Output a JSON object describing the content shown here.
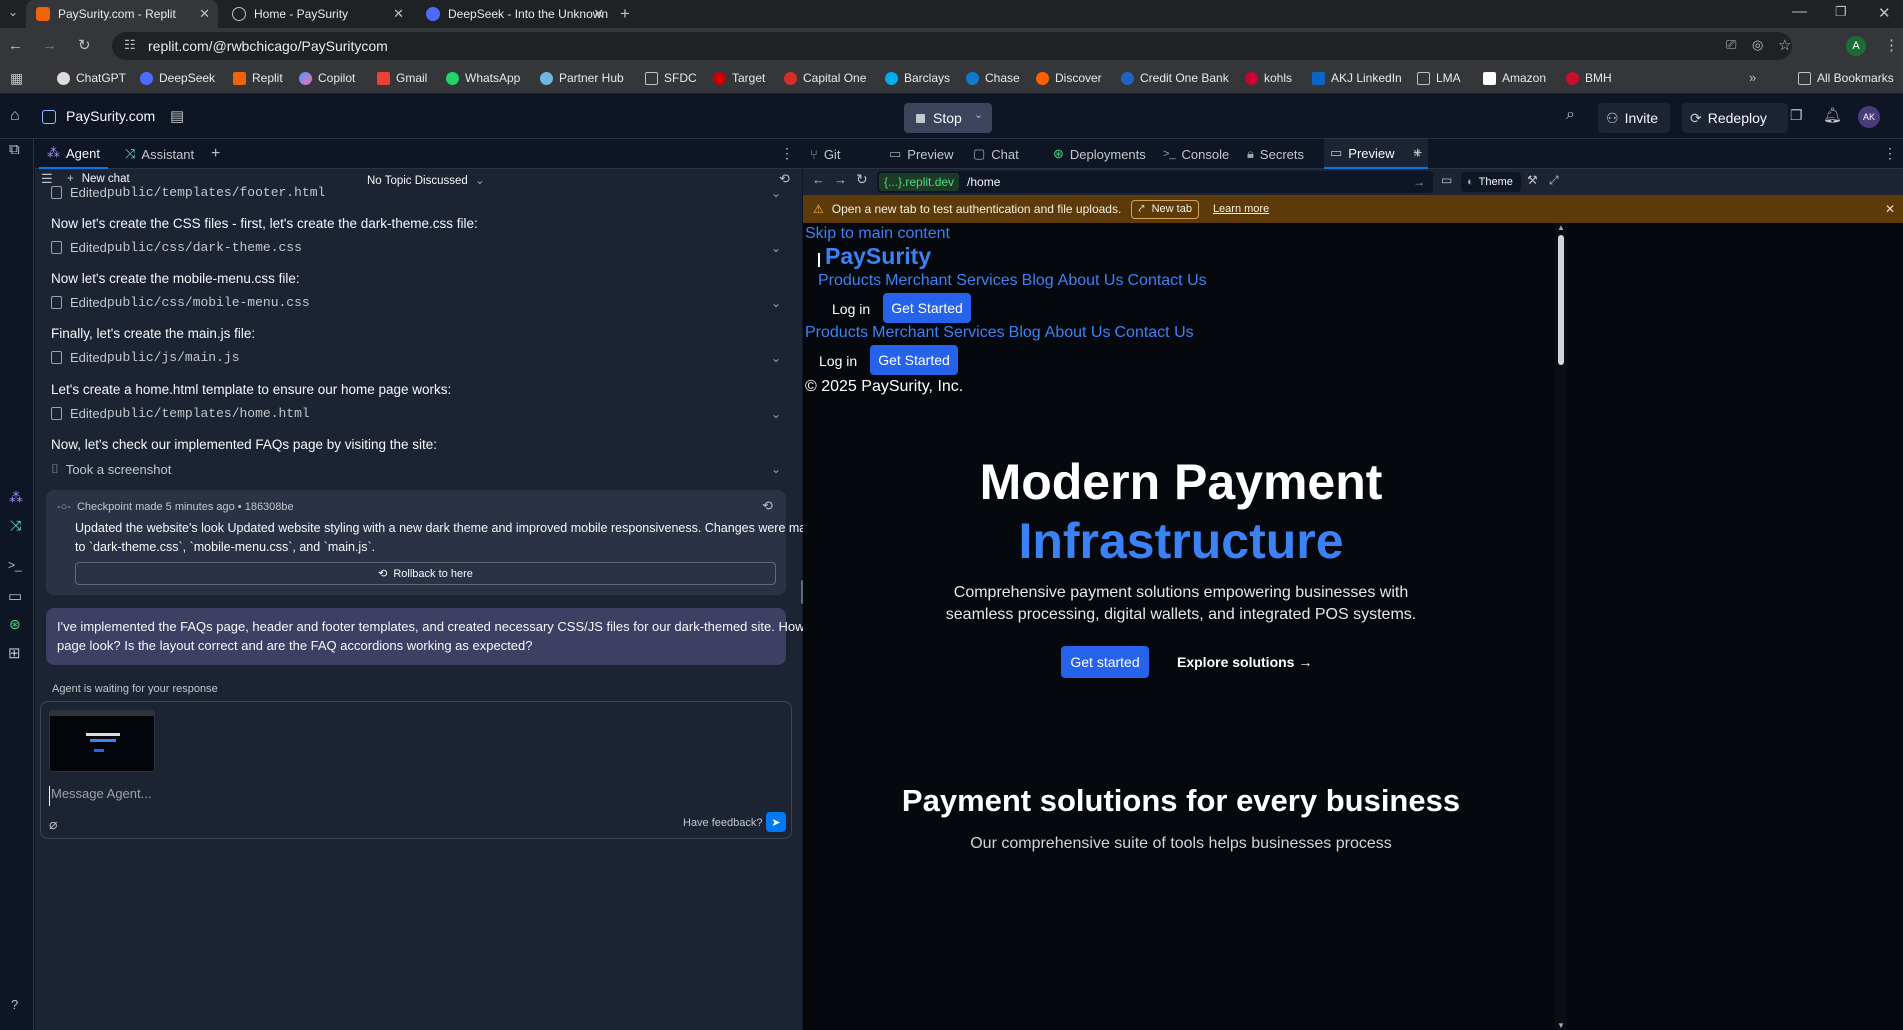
{
  "browser": {
    "tabs": [
      {
        "title": "PaySurity.com - Replit",
        "active": true
      },
      {
        "title": "Home - PaySurity",
        "active": false
      },
      {
        "title": "DeepSeek - Into the Unknown",
        "active": false
      }
    ],
    "url": "replit.com/@rwbchicago/PaySuritycom",
    "profile_initial": "A",
    "bookmarks": [
      "ChatGPT",
      "DeepSeek",
      "Replit",
      "Copilot",
      "Gmail",
      "WhatsApp",
      "Partner Hub",
      "SFDC",
      "Target",
      "Capital One",
      "Barclays",
      "Chase",
      "Discover",
      "Credit One Bank",
      "kohls",
      "AKJ LinkedIn",
      "LMA",
      "Amazon",
      "BMH"
    ],
    "all_bookmarks": "All Bookmarks"
  },
  "replit": {
    "project_name": "PaySurity.com",
    "stop_label": "Stop",
    "invite_label": "Invite",
    "redeploy_label": "Redeploy",
    "avatar_initials": "AK"
  },
  "agent_pane": {
    "tabs": [
      "Agent",
      "Assistant"
    ],
    "new_chat": "New chat",
    "topic": "No Topic Discussed",
    "items": [
      {
        "kind": "edit",
        "prefix": "Edited ",
        "file": "public/templates/footer.html"
      },
      {
        "kind": "text",
        "text": "Now let's create the CSS files - first, let's create the dark-theme.css file:"
      },
      {
        "kind": "edit",
        "prefix": "Edited ",
        "file": "public/css/dark-theme.css"
      },
      {
        "kind": "text",
        "text": "Now let's create the mobile-menu.css file:"
      },
      {
        "kind": "edit",
        "prefix": "Edited ",
        "file": "public/css/mobile-menu.css"
      },
      {
        "kind": "text",
        "text": "Finally, let's create the main.js file:"
      },
      {
        "kind": "edit",
        "prefix": "Edited ",
        "file": "public/js/main.js"
      },
      {
        "kind": "text",
        "text": "Let's create a home.html template to ensure our home page works:"
      },
      {
        "kind": "edit",
        "prefix": "Edited ",
        "file": "public/templates/home.html"
      },
      {
        "kind": "text",
        "text": "Now, let's check our implemented FAQs page by visiting the site:"
      },
      {
        "kind": "screenshot",
        "prefix": "Took a screenshot",
        "file": ""
      }
    ],
    "checkpoint": {
      "header": "Checkpoint made 5 minutes ago • 186308be",
      "line1": "Updated the website's look Updated website styling with a new dark theme and improved mobile responsiveness. Changes were made",
      "line2": "to `dark-theme.css`, `mobile-menu.css`, and `main.js`.",
      "rollback": "Rollback to here"
    },
    "question": {
      "line1": "I've implemented the FAQs page, header and footer templates, and created necessary CSS/JS files for our dark-themed site. How does the",
      "line2": "page look? Is the layout correct and are the FAQ accordions working as expected?"
    },
    "waiting": "Agent is waiting for your response",
    "input_placeholder": "Message Agent...",
    "feedback": "Have feedback?"
  },
  "right_pane": {
    "tabs": [
      "Git",
      "Preview",
      "Chat",
      "Deployments",
      "Console",
      "Secrets",
      "Preview"
    ],
    "url_host": "{...}.replit.dev",
    "url_path": "/home",
    "theme_label": "Theme",
    "warning": "Open a new tab to test authentication and file uploads.",
    "new_tab": "New tab",
    "learn_more": "Learn more"
  },
  "site": {
    "skip_link": "Skip to main content",
    "logo": "PaySurity",
    "nav": [
      "Products",
      "Merchant Services",
      "Blog",
      "About Us",
      "Contact Us"
    ],
    "login": "Log in",
    "get_started": "Get Started",
    "copyright": "© 2025 PaySurity, Inc.",
    "hero_line1": "Modern Payment",
    "hero_line2": "Infrastructure",
    "hero_sub1": "Comprehensive payment solutions empowering businesses with",
    "hero_sub2": "seamless processing, digital wallets, and integrated POS systems.",
    "cta_primary": "Get started",
    "cta_secondary": "Explore solutions →",
    "section_title": "Payment solutions for every business",
    "section_sub": "Our comprehensive suite of tools helps businesses process"
  },
  "colors": {
    "accent": "#0079f2",
    "brand_blue": "#3b82f6",
    "warn_bg": "#5c3a0a"
  }
}
